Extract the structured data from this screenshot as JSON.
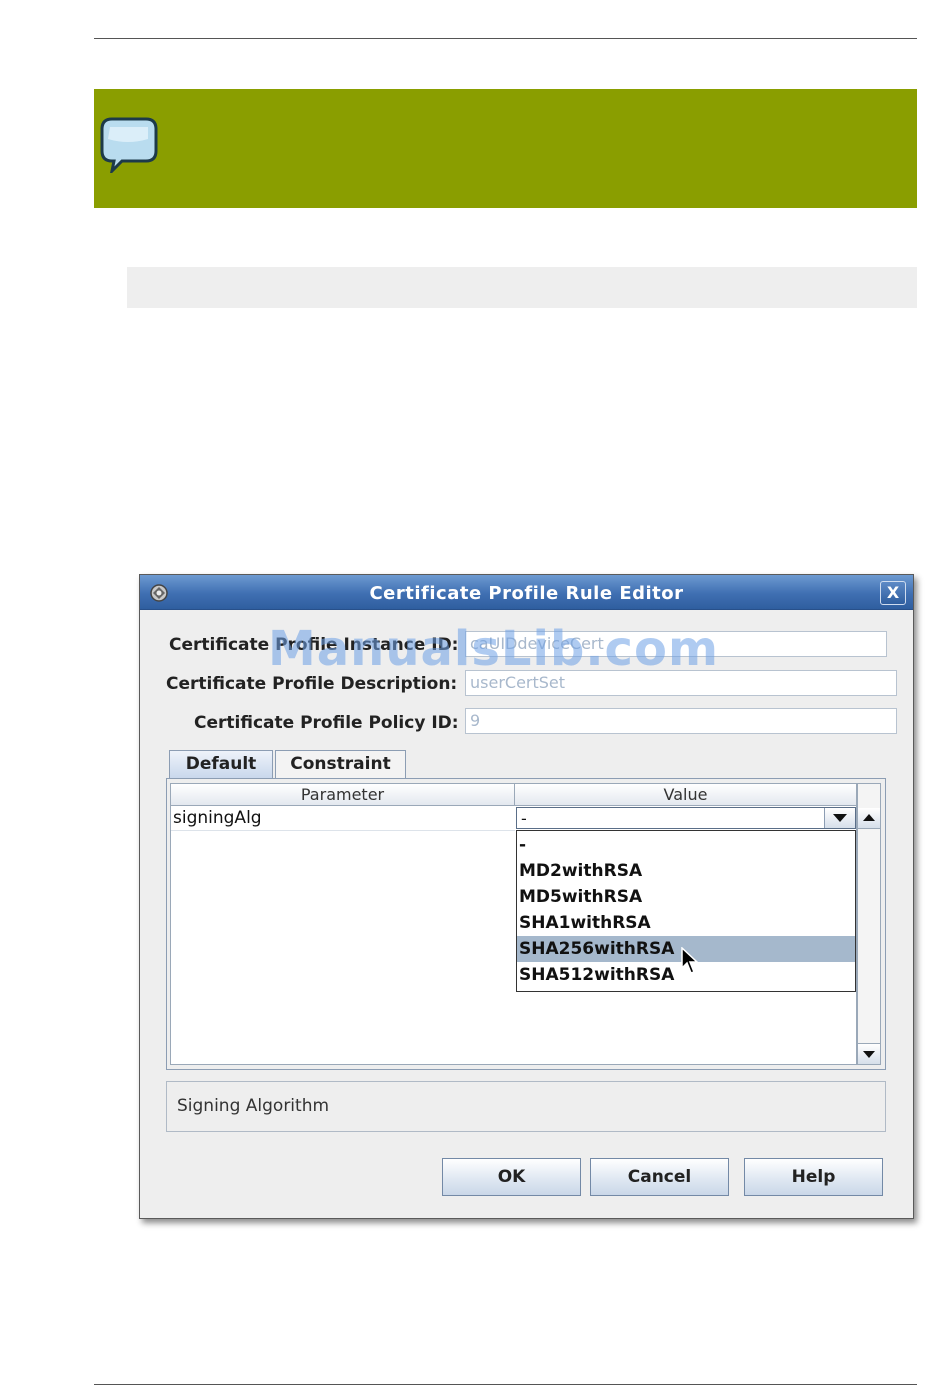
{
  "note_icon": "speech-bubble-icon",
  "dialog": {
    "title": "Certificate Profile Rule Editor",
    "title_icon": "app-icon",
    "close_label": "X",
    "watermark": "ManualsLib.com",
    "fields": {
      "instance_label": "Certificate Profile Instance ID:",
      "instance_value": "caUIDdeviceCert",
      "description_label": "Certificate Profile Description:",
      "description_value": "userCertSet",
      "policy_label": "Certificate Profile Policy ID:",
      "policy_value": "9"
    },
    "tabs": [
      {
        "label": "Default",
        "active": true
      },
      {
        "label": "Constraint",
        "active": false
      }
    ],
    "table": {
      "headers": [
        "Parameter",
        "Value"
      ],
      "rows": [
        {
          "parameter": "signingAlg",
          "value": "-"
        }
      ]
    },
    "dropdown": {
      "options": [
        "-",
        "MD2withRSA",
        "MD5withRSA",
        "SHA1withRSA",
        "SHA256withRSA",
        "SHA512withRSA"
      ],
      "highlighted": "SHA256withRSA"
    },
    "description": "Signing Algorithm",
    "buttons": {
      "ok": "OK",
      "cancel": "Cancel",
      "help": "Help"
    }
  },
  "colors": {
    "note_background": "#8a9e00",
    "titlebar": "#3f6fb2",
    "selection": "#a5b8cc"
  }
}
